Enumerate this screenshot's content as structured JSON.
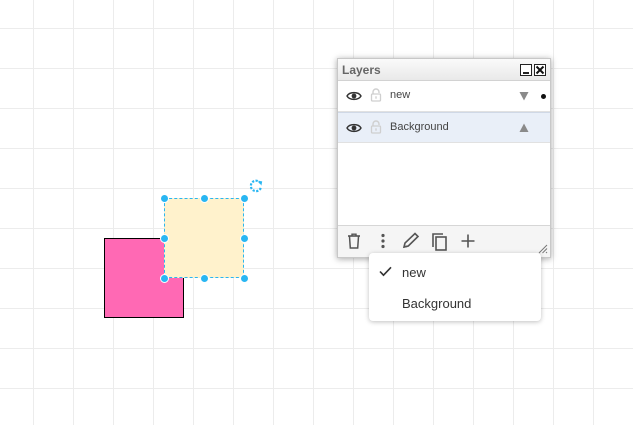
{
  "canvas": {
    "grid_color": "#ececec",
    "selection_color": "#29b6f2"
  },
  "shapes": [
    {
      "name": "pink-square",
      "fill": "#ff69b4",
      "stroke": "#000000"
    },
    {
      "name": "yellow-square",
      "fill": "#fff2cc",
      "selected": true
    }
  ],
  "layers_panel": {
    "title": "Layers",
    "layers": [
      {
        "label": "new",
        "visible": true,
        "locked": false,
        "move_icon": "triangle-down",
        "active": true
      },
      {
        "label": "Background",
        "visible": true,
        "locked": false,
        "move_icon": "triangle-up",
        "active": false
      }
    ],
    "toolbar": [
      "trash-icon",
      "more-vertical-icon",
      "pencil-icon",
      "copy-icon",
      "plus-icon"
    ]
  },
  "layer_menu": {
    "items": [
      {
        "label": "new",
        "checked": true
      },
      {
        "label": "Background",
        "checked": false
      }
    ]
  }
}
